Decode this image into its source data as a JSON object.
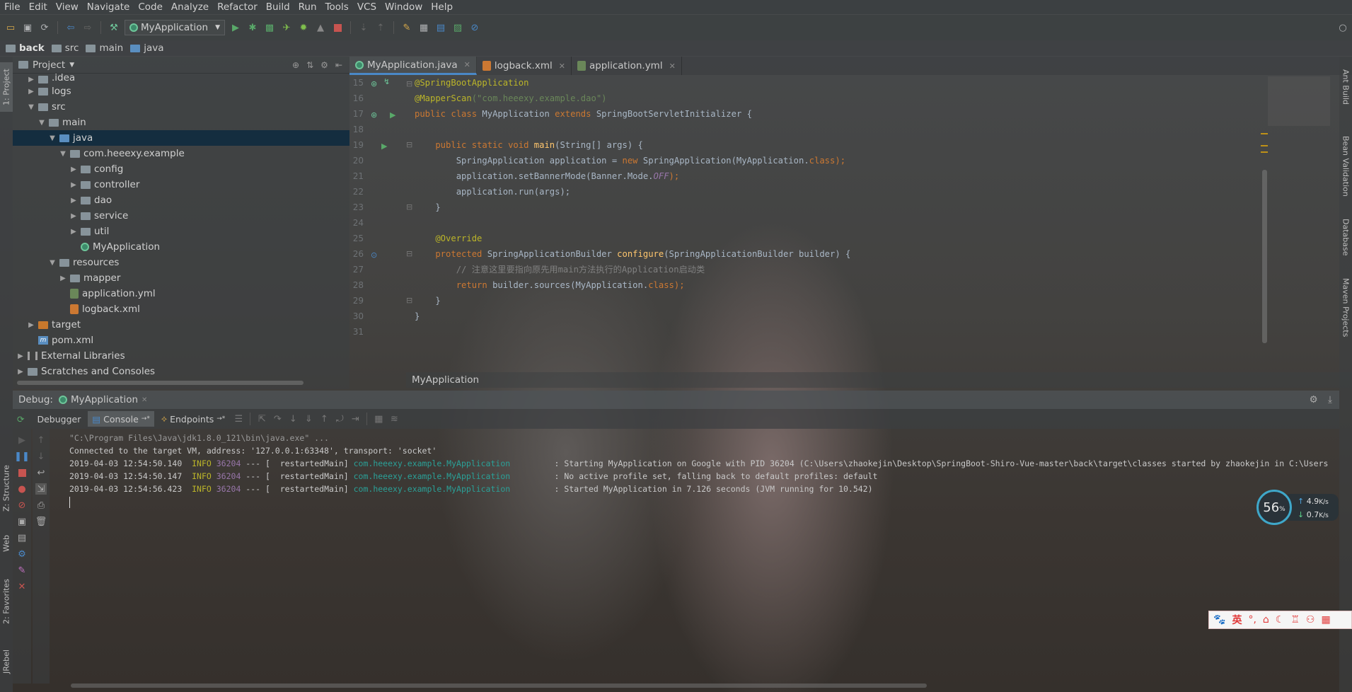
{
  "menu": [
    "File",
    "Edit",
    "View",
    "Navigate",
    "Code",
    "Analyze",
    "Refactor",
    "Build",
    "Run",
    "Tools",
    "VCS",
    "Window",
    "Help"
  ],
  "toolbar": {
    "run_config": "MyApplication"
  },
  "breadcrumb": [
    "back",
    "src",
    "main",
    "java"
  ],
  "left_strip": {
    "project": "1: Project",
    "structure": "Z: Structure",
    "web": "Web",
    "favorites": "2: Favorites",
    "jrebel": "JRebel"
  },
  "right_strip": {
    "ant": "Ant Build",
    "bean": "Bean Validation",
    "database": "Database",
    "maven": "Maven Projects"
  },
  "project": {
    "title": "Project",
    "tree": [
      {
        "label": ".idea",
        "depth": 1,
        "arrow": "▶",
        "icon": "folder"
      },
      {
        "label": "logs",
        "depth": 1,
        "arrow": "▶",
        "icon": "folder"
      },
      {
        "label": "src",
        "depth": 1,
        "arrow": "▼",
        "icon": "folder"
      },
      {
        "label": "main",
        "depth": 2,
        "arrow": "▼",
        "icon": "folder"
      },
      {
        "label": "java",
        "depth": 3,
        "arrow": "▼",
        "icon": "folder-blue",
        "selected": true
      },
      {
        "label": "com.heeexy.example",
        "depth": 4,
        "arrow": "▼",
        "icon": "package"
      },
      {
        "label": "config",
        "depth": 5,
        "arrow": "▶",
        "icon": "package"
      },
      {
        "label": "controller",
        "depth": 5,
        "arrow": "▶",
        "icon": "package"
      },
      {
        "label": "dao",
        "depth": 5,
        "arrow": "▶",
        "icon": "package"
      },
      {
        "label": "service",
        "depth": 5,
        "arrow": "▶",
        "icon": "package"
      },
      {
        "label": "util",
        "depth": 5,
        "arrow": "▶",
        "icon": "package"
      },
      {
        "label": "MyApplication",
        "depth": 5,
        "arrow": "",
        "icon": "java"
      },
      {
        "label": "resources",
        "depth": 3,
        "arrow": "▼",
        "icon": "folder"
      },
      {
        "label": "mapper",
        "depth": 4,
        "arrow": "▶",
        "icon": "folder"
      },
      {
        "label": "application.yml",
        "depth": 4,
        "arrow": "",
        "icon": "yml"
      },
      {
        "label": "logback.xml",
        "depth": 4,
        "arrow": "",
        "icon": "xml"
      },
      {
        "label": "target",
        "depth": 1,
        "arrow": "▶",
        "icon": "folder-orange"
      },
      {
        "label": "pom.xml",
        "depth": 1,
        "arrow": "",
        "icon": "pom"
      },
      {
        "label": "External Libraries",
        "depth": 0,
        "arrow": "▶",
        "icon": "lib"
      },
      {
        "label": "Scratches and Consoles",
        "depth": 0,
        "arrow": "▶",
        "icon": "scratch"
      }
    ]
  },
  "editor": {
    "tabs": [
      {
        "label": "MyApplication.java",
        "icon": "java",
        "active": true
      },
      {
        "label": "logback.xml",
        "icon": "xml",
        "active": false
      },
      {
        "label": "application.yml",
        "icon": "yml",
        "active": false
      }
    ],
    "line_numbers": [
      "15",
      "16",
      "17",
      "18",
      "19",
      "20",
      "21",
      "22",
      "23",
      "24",
      "25",
      "26",
      "27",
      "28",
      "29",
      "30",
      "31"
    ],
    "code": {
      "l15": "@SpringBootApplication",
      "l16a": "@MapperScan",
      "l16b": "(\"com.heeexy.example.dao\")",
      "l17a": "public class ",
      "l17b": "MyApplication ",
      "l17c": "extends ",
      "l17d": "SpringBootServletInitializer {",
      "l19a": "    public static void ",
      "l19b": "main",
      "l19c": "(String[] args) {",
      "l20a": "        SpringApplication application = ",
      "l20b": "new ",
      "l20c": "SpringApplication(MyApplication.",
      "l20d": "class",
      "l20e": ");",
      "l21a": "        application.setBannerMode(Banner.Mode.",
      "l21b": "OFF",
      "l21c": ");",
      "l22": "        application.run(args);",
      "l23": "    }",
      "l25": "    @Override",
      "l26a": "    protected ",
      "l26b": "SpringApplicationBuilder ",
      "l26c": "configure",
      "l26d": "(SpringApplicationBuilder builder) {",
      "l27": "        // 注意这里要指向原先用main方法执行的Application启动类",
      "l28a": "        return ",
      "l28b": "builder.sources(MyApplication.",
      "l28c": "class",
      "l28d": ");",
      "l29": "    }",
      "l30": "}"
    },
    "bottom_breadcrumb": "MyApplication"
  },
  "debug": {
    "label": "Debug:",
    "session": "MyApplication",
    "tabs": [
      "Debugger",
      "Console",
      "Endpoints"
    ],
    "console": {
      "l1": "\"C:\\Program Files\\Java\\jdk1.8.0_121\\bin\\java.exe\" ...",
      "l2": "Connected to the target VM, address: '127.0.0.1:63348', transport: 'socket'",
      "rows": [
        {
          "ts": "2019-04-03 12:54:50.140",
          "level": "INFO",
          "pid": "36204",
          "thread": " --- [  restartedMain] ",
          "logger": "com.heeexy.example.MyApplication",
          "msg": "         : Starting MyApplication on Google with PID 36204 (C:\\Users\\zhaokejin\\Desktop\\SpringBoot-Shiro-Vue-master\\back\\target\\classes started by zhaokejin in C:\\Users"
        },
        {
          "ts": "2019-04-03 12:54:50.147",
          "level": "INFO",
          "pid": "36204",
          "thread": " --- [  restartedMain] ",
          "logger": "com.heeexy.example.MyApplication",
          "msg": "         : No active profile set, falling back to default profiles: default"
        },
        {
          "ts": "2019-04-03 12:54:56.423",
          "level": "INFO",
          "pid": "36204",
          "thread": " --- [  restartedMain] ",
          "logger": "com.heeexy.example.MyApplication",
          "msg": "         : Started MyApplication in 7.126 seconds (JVM running for 10.542)"
        }
      ]
    }
  },
  "net_meter": {
    "percent": "56",
    "percent_sign": "%",
    "up": "4.9",
    "up_unit": "K/s",
    "down": "0.7",
    "down_unit": "K/s"
  },
  "ime": {
    "lang": "英"
  },
  "colors": {
    "accent": "#4a88c7",
    "selected": "#0d293e",
    "keyword": "#cc7832",
    "annotation": "#bbb529"
  }
}
